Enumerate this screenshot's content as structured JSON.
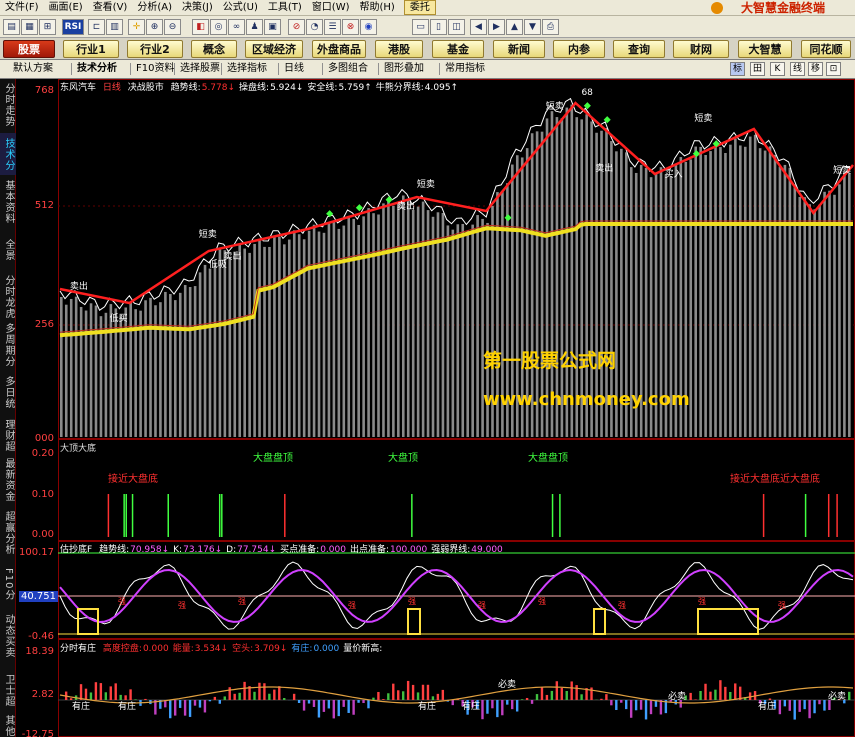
{
  "menubar": {
    "items": [
      "文件(F)",
      "画面(E)",
      "查看(V)",
      "分析(A)",
      "决策(J)",
      "公式(U)",
      "工具(T)",
      "窗口(W)",
      "帮助(H)",
      "委托"
    ],
    "app_title": "大智慧金融终端"
  },
  "toolbar": {
    "rsi": "RSI"
  },
  "nav": {
    "items": [
      "股票",
      "行业1",
      "行业2",
      "概念",
      "区域经济",
      "外盘商品",
      "港股",
      "基金",
      "新闻",
      "内参",
      "查询",
      "财网",
      "大智慧",
      "同花顺"
    ]
  },
  "tabs": {
    "items": [
      "默认方案",
      "技术分析",
      "F10资料",
      "选择股票",
      "选择指标",
      "日线",
      "多图组合",
      "图形叠加",
      "常用指标"
    ],
    "right": [
      "标",
      "田",
      "K",
      "线",
      "移",
      "⊡"
    ]
  },
  "sidebar": {
    "items": [
      "分时走势",
      "技术分析",
      "基本资料",
      "全景",
      "分时龙虎",
      "多周期分布",
      "多日统计",
      "理财超赢",
      "最新资金",
      "超赢分析",
      "F10分",
      "动态买卖",
      "卫士超赢",
      "其他"
    ]
  },
  "colors": {
    "up": "#ff3030",
    "accent": "#ffd200",
    "ma_yellow": "#f0e020",
    "grid": "#600000"
  },
  "main_panel": {
    "stock": "东风汽车",
    "period": "日线",
    "indicator": "决战股市",
    "fields": [
      {
        "label": "趋势线:",
        "value": "5.778↓",
        "color": "#ff3030"
      },
      {
        "label": "操盘线:",
        "value": "5.924↓",
        "color": "#ffffff"
      },
      {
        "label": "安全线:",
        "value": "5.759↑",
        "color": "#ffffff"
      },
      {
        "label": "牛熊分界线:",
        "value": "4.095↑",
        "color": "#ffffff"
      }
    ],
    "y_ticks": [
      "768",
      "512",
      "256",
      "000"
    ],
    "peak_label": "68",
    "annotations": {
      "short_sell": "短卖",
      "sell_out": "卖出",
      "buy_in": "买入",
      "buy_low": "低吸",
      "sell_low": "低买"
    }
  },
  "panel2": {
    "title": "大顶大底",
    "y_ticks": [
      "0.20",
      "0.10",
      "0.00"
    ],
    "labels": {
      "big_top": "大盘顶",
      "near_bottom": "接近大盘底",
      "near_top_combo": "大盘盘顶",
      "near_bottom_combo": "接近大盘底近大盘底"
    }
  },
  "panel3": {
    "title": "估抄底F",
    "fields": [
      {
        "label": "趋势线:",
        "value": "70.958↓"
      },
      {
        "label": "K:",
        "value": "73.176↓"
      },
      {
        "label": "D:",
        "value": "77.754↓"
      },
      {
        "label": "买点准备:",
        "value": "0.000"
      },
      {
        "label": "出点准备:",
        "value": "100.000"
      },
      {
        "label": "强弱界线:",
        "value": "49.000"
      }
    ],
    "y_ticks": [
      "100.17",
      "40.751",
      "-0.46"
    ],
    "label_strong": "强"
  },
  "panel4": {
    "title": "分时有庄",
    "fields": [
      {
        "label": "高度控盘:",
        "value": "0.000",
        "color": "#ff3030"
      },
      {
        "label": "能量:",
        "value": "3.534↓",
        "color": "#ff3030"
      },
      {
        "label": "空头:",
        "value": "3.709↓",
        "color": "#ff3030"
      },
      {
        "label": "有庄:",
        "value": "0.000",
        "color": "#40a0ff"
      },
      {
        "label": "量价新高:",
        "value": "",
        "color": "#ffffff"
      }
    ],
    "y_ticks": [
      "18.39",
      "2.82",
      "-12.75"
    ],
    "label_zhuang": "有庄",
    "label_must": "必卖"
  },
  "watermark": {
    "line1": "第一股票公式网",
    "line2": "www.chnmoney.com"
  }
}
